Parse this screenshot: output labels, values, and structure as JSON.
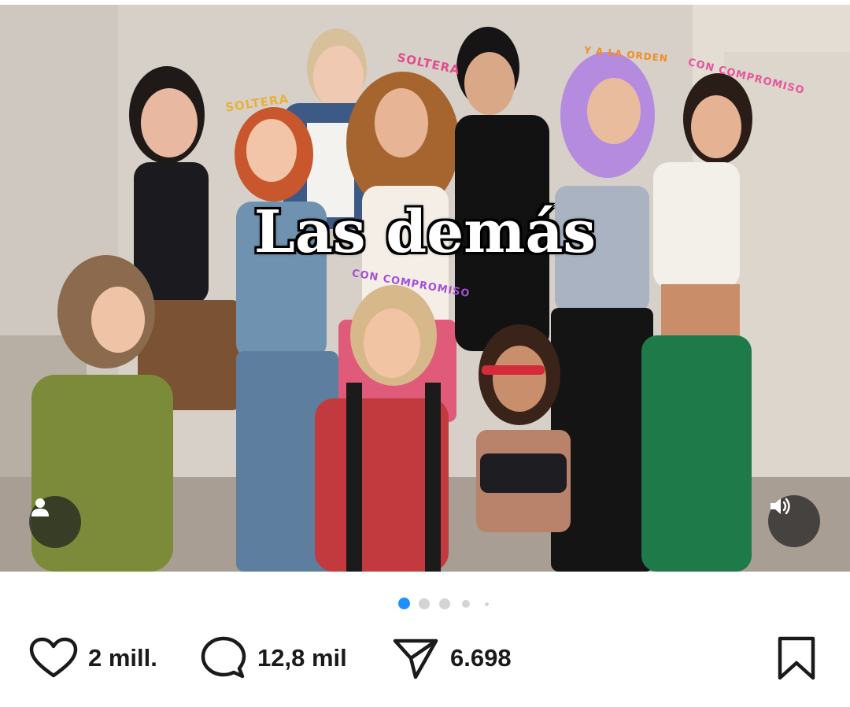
{
  "post": {
    "image_alt_icon": "group-photo",
    "overlay_caption": "Las demás",
    "headbands": [
      {
        "text": "SOLTERA",
        "color": "#e8b13a"
      },
      {
        "text": "SOLTERA",
        "color": "#e44b8a"
      },
      {
        "text": "Y A LA ORDEN",
        "color": "#f08c2a"
      },
      {
        "text": "CON COMPROMISO",
        "color": "#e6559a"
      },
      {
        "text": "CON COMPROMISO",
        "color": "#a34fd6"
      }
    ],
    "user_tag_icon": "person-icon",
    "sound_icon": "speaker-icon"
  },
  "carousel": {
    "total": 5,
    "active_index": 0,
    "active_color": "#1e90ff",
    "inactive_color": "#d4d4d4"
  },
  "actions": {
    "likes": "2 mill.",
    "comments": "12,8 mil",
    "shares": "6.698"
  },
  "colors": {
    "icon": "#1a1a1a",
    "background": "#ffffff"
  }
}
